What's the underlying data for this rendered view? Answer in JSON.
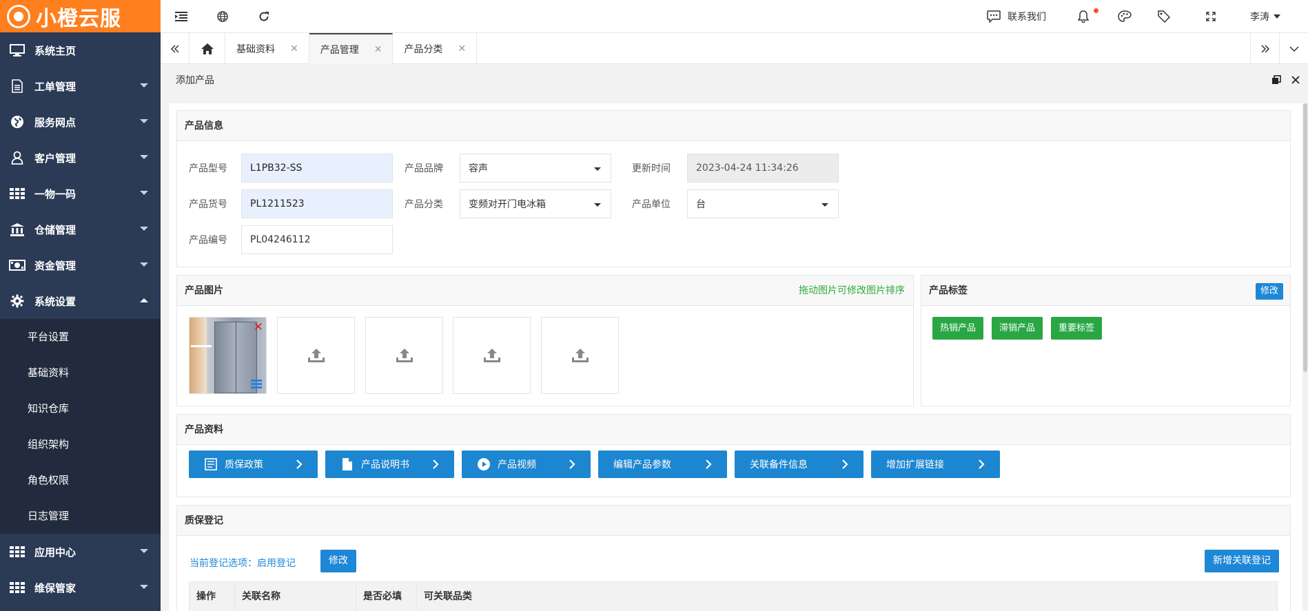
{
  "app": {
    "logo_text": "小橙云服"
  },
  "sidebar": {
    "items": [
      {
        "label": "系统主页",
        "icon": "monitor-icon"
      },
      {
        "label": "工单管理",
        "icon": "document-icon"
      },
      {
        "label": "服务网点",
        "icon": "globe-icon"
      },
      {
        "label": "客户管理",
        "icon": "user-icon"
      },
      {
        "label": "一物一码",
        "icon": "grid-icon"
      },
      {
        "label": "仓储管理",
        "icon": "bank-icon"
      },
      {
        "label": "资金管理",
        "icon": "money-icon"
      },
      {
        "label": "系统设置",
        "icon": "gear-icon"
      }
    ],
    "sub_items": [
      "平台设置",
      "基础资料",
      "知识仓库",
      "组织架构",
      "角色权限",
      "日志管理"
    ],
    "bottom_items": [
      {
        "label": "应用中心",
        "icon": "grid-icon"
      },
      {
        "label": "维保管家",
        "icon": "grid-icon"
      }
    ]
  },
  "topbar": {
    "contact_label": "联系我们",
    "user_name": "李涛"
  },
  "tabs": [
    {
      "label": "基础资料"
    },
    {
      "label": "产品管理"
    },
    {
      "label": "产品分类"
    }
  ],
  "page": {
    "title": "添加产品"
  },
  "product_info": {
    "title": "产品信息",
    "model_label": "产品型号",
    "model_value": "L1PB32-SS",
    "brand_label": "产品品牌",
    "brand_value": "容声",
    "updated_label": "更新时间",
    "updated_value": "2023-04-24 11:34:26",
    "sku_label": "产品货号",
    "sku_value": "PL1211523",
    "category_label": "产品分类",
    "category_value": "变频对开门电冰箱",
    "unit_label": "产品单位",
    "unit_value": "台",
    "code_label": "产品编号",
    "code_value": "PL04246112"
  },
  "product_images": {
    "title": "产品图片",
    "hint": "拖动图片可修改图片排序"
  },
  "product_tags": {
    "title": "产品标签",
    "edit_label": "修改",
    "tags": [
      "热销产品",
      "滞销产品",
      "重要标签"
    ]
  },
  "product_docs": {
    "title": "产品资料",
    "buttons": [
      {
        "label": "质保政策",
        "icon": "policy-icon"
      },
      {
        "label": "产品说明书",
        "icon": "file-icon"
      },
      {
        "label": "产品视频",
        "icon": "play-icon"
      },
      {
        "label": "编辑产品参数",
        "icon": ""
      },
      {
        "label": "关联备件信息",
        "icon": ""
      },
      {
        "label": "增加扩展链接",
        "icon": ""
      }
    ]
  },
  "warranty": {
    "title": "质保登记",
    "option_text": "当前登记选项：启用登记",
    "edit_label": "修改",
    "add_label": "新增关联登记",
    "columns": [
      "操作",
      "关联名称",
      "是否必填",
      "可关联品类"
    ]
  },
  "colors": {
    "logo_bg": "#ff7f1f",
    "sidebar_bg": "#2b3a55",
    "primary": "#1e88d6",
    "tag_green": "#29a744",
    "hint_green": "#2faa3d"
  }
}
